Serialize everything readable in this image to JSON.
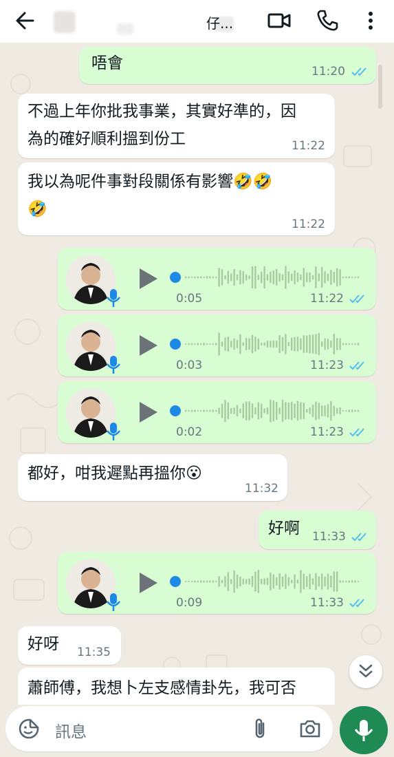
{
  "header": {
    "contact_name": "仔..."
  },
  "messages": [
    {
      "text": "唔會",
      "time": "11:20"
    },
    {
      "text": "不過上年你批我事業，其實好準的，因\n為的確好順利搵到份工",
      "time": "11:22"
    },
    {
      "text": "我以為呢件事對段關係有影響🤣🤣\n🤣",
      "time": "11:22"
    },
    {
      "duration": "0:05",
      "time": "11:22"
    },
    {
      "duration": "0:03",
      "time": "11:23"
    },
    {
      "duration": "0:02",
      "time": "11:23"
    },
    {
      "text": "都好，咁我遲點再搵你😮",
      "time": "11:32"
    },
    {
      "text": "好啊",
      "time": "11:33"
    },
    {
      "duration": "0:09",
      "time": "11:33"
    },
    {
      "text": "好呀",
      "time": "11:35"
    },
    {
      "text": "蕭師傅，我想卜左支感情卦先，我可否"
    }
  ],
  "composer": {
    "placeholder": "訊息"
  },
  "colors": {
    "outgoing_bubble": "#d9fdd3",
    "incoming_bubble": "#ffffff",
    "read_ticks": "#53bdeb",
    "send_button": "#1f8a54",
    "voice_dot": "#1e88e5"
  },
  "icons": [
    "back-arrow-icon",
    "video-call-icon",
    "phone-call-icon",
    "more-vert-icon",
    "double-check-icon",
    "play-icon",
    "mic-icon",
    "chevron-double-down-icon",
    "sticker-icon",
    "attach-icon",
    "camera-icon"
  ]
}
